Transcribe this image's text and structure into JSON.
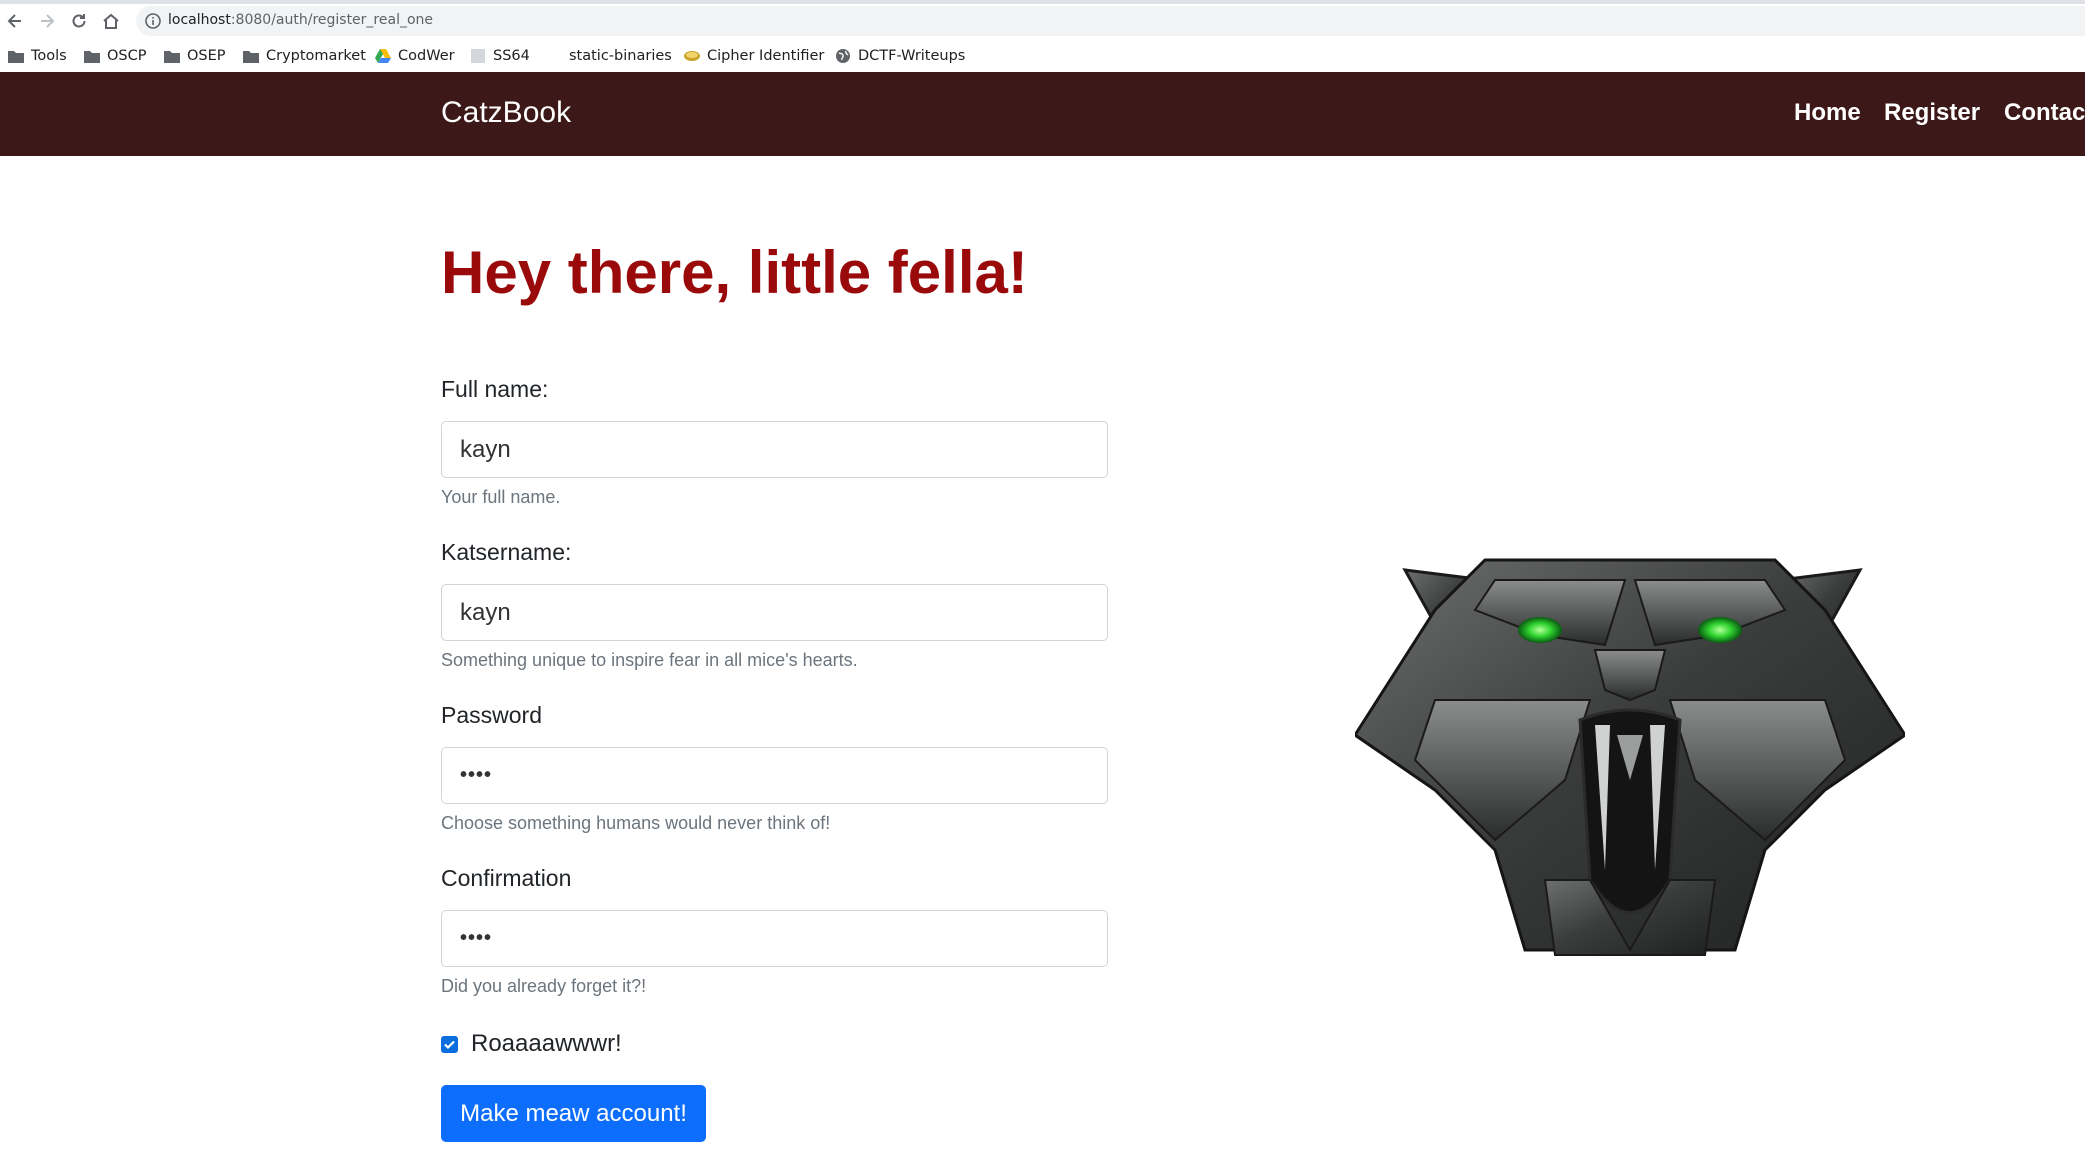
{
  "browser": {
    "url_host": "localhost",
    "url_rest": ":8080/auth/register_real_one",
    "bookmarks": [
      {
        "label": "Tools",
        "icon": "folder-icon"
      },
      {
        "label": "OSCP",
        "icon": "folder-icon"
      },
      {
        "label": "OSEP",
        "icon": "folder-icon"
      },
      {
        "label": "Cryptomarket",
        "icon": "folder-icon"
      },
      {
        "label": "CodWer",
        "icon": "google-drive-icon"
      },
      {
        "label": "SS64",
        "icon": "page-icon"
      },
      {
        "label": "static-binaries",
        "icon": "blank-icon"
      },
      {
        "label": "Cipher Identifier",
        "icon": "dcode-icon"
      },
      {
        "label": "DCTF-Writeups",
        "icon": "globe-icon"
      }
    ]
  },
  "navbar": {
    "brand": "CatzBook",
    "links": [
      "Home",
      "Register",
      "Contac"
    ],
    "background": "#3c1818"
  },
  "main": {
    "heading": "Hey there, little fella!",
    "heading_color": "#9b0a0a",
    "fields": [
      {
        "label": "Full name:",
        "value": "kayn",
        "help": "Your full name."
      },
      {
        "label": "Katsername:",
        "value": "kayn",
        "help": "Something unique to inspire fear in all mice's hearts."
      },
      {
        "label": "Password",
        "value": "••••",
        "help": "Choose something humans would never think of!"
      },
      {
        "label": "Confirmation",
        "value": "••••",
        "help": "Did you already forget it?!"
      }
    ],
    "checkbox": {
      "label": "Roaaaawwwr!",
      "checked": true
    },
    "submit_label": "Make meaw account!",
    "submit_color": "#0d6efd"
  }
}
